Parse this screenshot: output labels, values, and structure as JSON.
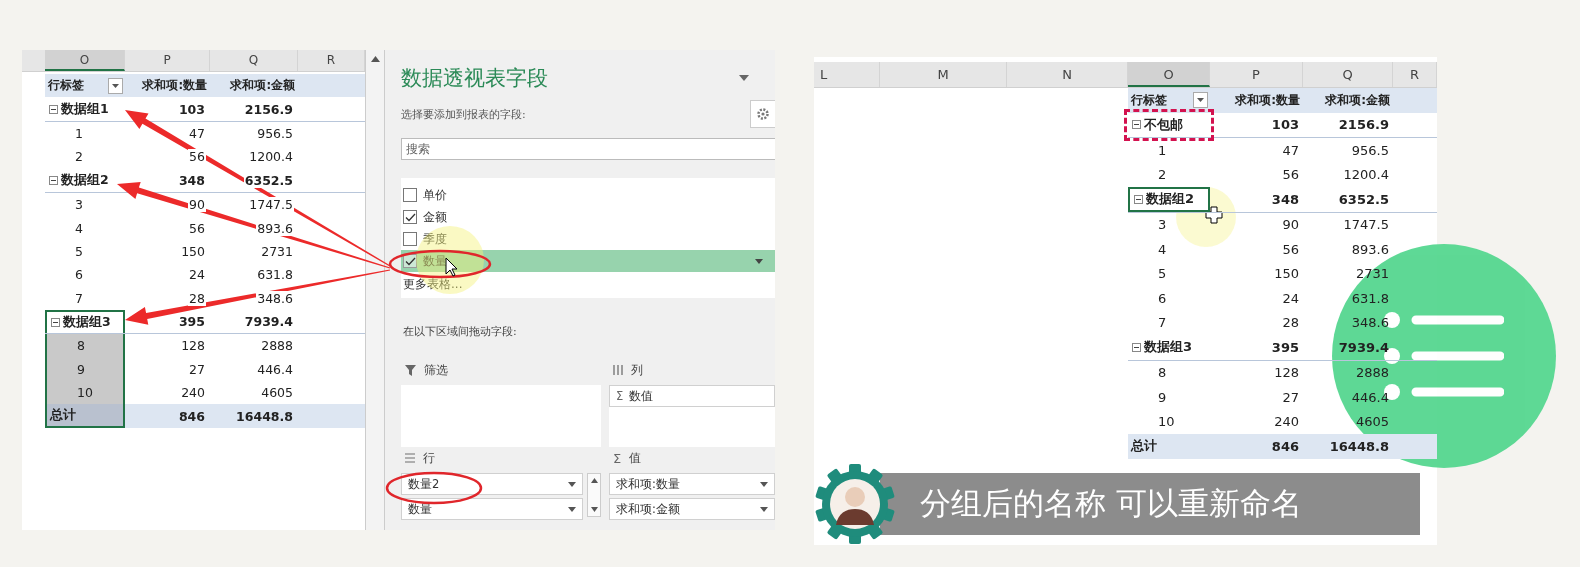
{
  "left_sheet": {
    "columns": [
      {
        "label": "O",
        "selected": true
      },
      {
        "label": "P",
        "selected": false
      },
      {
        "label": "Q",
        "selected": false
      },
      {
        "label": "R",
        "selected": false
      }
    ],
    "header": {
      "row_label": "行标签",
      "qty": "求和项:数量",
      "amount": "求和项:金额"
    },
    "rows": [
      {
        "kind": "group",
        "label": "数据组1",
        "qty": "103",
        "amount": "2156.9",
        "selected": false
      },
      {
        "kind": "item",
        "label": "1",
        "qty": "47",
        "amount": "956.5",
        "selected": false
      },
      {
        "kind": "item",
        "label": "2",
        "qty": "56",
        "amount": "1200.4",
        "selected": false
      },
      {
        "kind": "group",
        "label": "数据组2",
        "qty": "348",
        "amount": "6352.5",
        "selected": false
      },
      {
        "kind": "item",
        "label": "3",
        "qty": "90",
        "amount": "1747.5",
        "selected": false
      },
      {
        "kind": "item",
        "label": "4",
        "qty": "56",
        "amount": "893.6",
        "selected": false
      },
      {
        "kind": "item",
        "label": "5",
        "qty": "150",
        "amount": "2731",
        "selected": false
      },
      {
        "kind": "item",
        "label": "6",
        "qty": "24",
        "amount": "631.8",
        "selected": false
      },
      {
        "kind": "item",
        "label": "7",
        "qty": "28",
        "amount": "348.6",
        "selected": false
      },
      {
        "kind": "group",
        "label": "数据组3",
        "qty": "395",
        "amount": "7939.4",
        "selected": true
      },
      {
        "kind": "item",
        "label": "8",
        "qty": "128",
        "amount": "2888",
        "selected": true
      },
      {
        "kind": "item",
        "label": "9",
        "qty": "27",
        "amount": "446.4",
        "selected": true
      },
      {
        "kind": "item",
        "label": "10",
        "qty": "240",
        "amount": "4605",
        "selected": true
      },
      {
        "kind": "total",
        "label": "总计",
        "qty": "846",
        "amount": "16448.8",
        "selected": true
      }
    ]
  },
  "field_panel": {
    "title": "数据透视表字段",
    "subtitle": "选择要添加到报表的字段:",
    "search": {
      "placeholder": "搜索"
    },
    "fields": [
      {
        "label": "单价",
        "checked": false,
        "selected": false
      },
      {
        "label": "金额",
        "checked": true,
        "selected": false
      },
      {
        "label": "季度",
        "checked": false,
        "selected": false
      },
      {
        "label": "数量",
        "checked": true,
        "selected": true
      }
    ],
    "more_tables": "更多表格...",
    "areas_hint": "在以下区域间拖动字段:",
    "areas": [
      {
        "kind": "filter",
        "label": "筛选"
      },
      {
        "kind": "columns",
        "label": "列",
        "items": [
          {
            "label": "数值",
            "prefix": "Σ"
          }
        ]
      },
      {
        "kind": "rows",
        "label": "行",
        "items": [
          {
            "label": "数量2"
          },
          {
            "label": "数量"
          }
        ]
      },
      {
        "kind": "values",
        "label": "值",
        "symbol": "Σ",
        "items": [
          {
            "label": "求和项:数量"
          },
          {
            "label": "求和项:金额"
          }
        ]
      }
    ]
  },
  "right_sheet": {
    "columns": [
      {
        "label": "L",
        "selected": false
      },
      {
        "label": "M",
        "selected": false
      },
      {
        "label": "N",
        "selected": false
      },
      {
        "label": "O",
        "selected": true
      },
      {
        "label": "P",
        "selected": false
      },
      {
        "label": "Q",
        "selected": false
      },
      {
        "label": "R",
        "selected": false
      }
    ],
    "header": {
      "row_label": "行标签",
      "qty": "求和项:数量",
      "amount": "求和项:金额"
    },
    "rows": [
      {
        "kind": "group",
        "label": "不包邮",
        "qty": "103",
        "amount": "2156.9",
        "selected": false,
        "marked": true
      },
      {
        "kind": "item",
        "label": "1",
        "qty": "47",
        "amount": "956.5",
        "selected": false,
        "marked": false
      },
      {
        "kind": "item",
        "label": "2",
        "qty": "56",
        "amount": "1200.4",
        "selected": false,
        "marked": false
      },
      {
        "kind": "group",
        "label": "数据组2",
        "qty": "348",
        "amount": "6352.5",
        "selected": true,
        "marked": false
      },
      {
        "kind": "item",
        "label": "3",
        "qty": "90",
        "amount": "1747.5",
        "selected": false,
        "marked": false
      },
      {
        "kind": "item",
        "label": "4",
        "qty": "56",
        "amount": "893.6",
        "selected": false,
        "marked": false
      },
      {
        "kind": "item",
        "label": "5",
        "qty": "150",
        "amount": "2731",
        "selected": false,
        "marked": false
      },
      {
        "kind": "item",
        "label": "6",
        "qty": "24",
        "amount": "631.8",
        "selected": false,
        "marked": false
      },
      {
        "kind": "item",
        "label": "7",
        "qty": "28",
        "amount": "348.6",
        "selected": false,
        "marked": false
      },
      {
        "kind": "group",
        "label": "数据组3",
        "qty": "395",
        "amount": "7939.4",
        "selected": false,
        "marked": false
      },
      {
        "kind": "item",
        "label": "8",
        "qty": "128",
        "amount": "2888",
        "selected": false,
        "marked": false
      },
      {
        "kind": "item",
        "label": "9",
        "qty": "27",
        "amount": "446.4",
        "selected": false,
        "marked": false
      },
      {
        "kind": "item",
        "label": "10",
        "qty": "240",
        "amount": "4605",
        "selected": false,
        "marked": false
      },
      {
        "kind": "total",
        "label": "总计",
        "qty": "846",
        "amount": "16448.8",
        "selected": false,
        "marked": false
      }
    ]
  },
  "caption": "分组后的名称 可以重新命名"
}
